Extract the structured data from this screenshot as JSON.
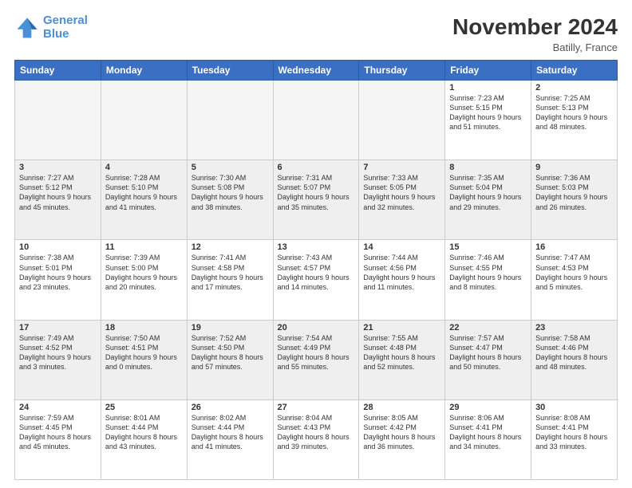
{
  "logo": {
    "line1": "General",
    "line2": "Blue"
  },
  "title": "November 2024",
  "location": "Batilly, France",
  "weekdays": [
    "Sunday",
    "Monday",
    "Tuesday",
    "Wednesday",
    "Thursday",
    "Friday",
    "Saturday"
  ],
  "rows": [
    [
      {
        "day": "",
        "empty": true
      },
      {
        "day": "",
        "empty": true
      },
      {
        "day": "",
        "empty": true
      },
      {
        "day": "",
        "empty": true
      },
      {
        "day": "",
        "empty": true
      },
      {
        "day": "1",
        "sunrise": "7:23 AM",
        "sunset": "5:15 PM",
        "daylight": "9 hours and 51 minutes."
      },
      {
        "day": "2",
        "sunrise": "7:25 AM",
        "sunset": "5:13 PM",
        "daylight": "9 hours and 48 minutes."
      }
    ],
    [
      {
        "day": "3",
        "sunrise": "7:27 AM",
        "sunset": "5:12 PM",
        "daylight": "9 hours and 45 minutes."
      },
      {
        "day": "4",
        "sunrise": "7:28 AM",
        "sunset": "5:10 PM",
        "daylight": "9 hours and 41 minutes."
      },
      {
        "day": "5",
        "sunrise": "7:30 AM",
        "sunset": "5:08 PM",
        "daylight": "9 hours and 38 minutes."
      },
      {
        "day": "6",
        "sunrise": "7:31 AM",
        "sunset": "5:07 PM",
        "daylight": "9 hours and 35 minutes."
      },
      {
        "day": "7",
        "sunrise": "7:33 AM",
        "sunset": "5:05 PM",
        "daylight": "9 hours and 32 minutes."
      },
      {
        "day": "8",
        "sunrise": "7:35 AM",
        "sunset": "5:04 PM",
        "daylight": "9 hours and 29 minutes."
      },
      {
        "day": "9",
        "sunrise": "7:36 AM",
        "sunset": "5:03 PM",
        "daylight": "9 hours and 26 minutes."
      }
    ],
    [
      {
        "day": "10",
        "sunrise": "7:38 AM",
        "sunset": "5:01 PM",
        "daylight": "9 hours and 23 minutes."
      },
      {
        "day": "11",
        "sunrise": "7:39 AM",
        "sunset": "5:00 PM",
        "daylight": "9 hours and 20 minutes."
      },
      {
        "day": "12",
        "sunrise": "7:41 AM",
        "sunset": "4:58 PM",
        "daylight": "9 hours and 17 minutes."
      },
      {
        "day": "13",
        "sunrise": "7:43 AM",
        "sunset": "4:57 PM",
        "daylight": "9 hours and 14 minutes."
      },
      {
        "day": "14",
        "sunrise": "7:44 AM",
        "sunset": "4:56 PM",
        "daylight": "9 hours and 11 minutes."
      },
      {
        "day": "15",
        "sunrise": "7:46 AM",
        "sunset": "4:55 PM",
        "daylight": "9 hours and 8 minutes."
      },
      {
        "day": "16",
        "sunrise": "7:47 AM",
        "sunset": "4:53 PM",
        "daylight": "9 hours and 5 minutes."
      }
    ],
    [
      {
        "day": "17",
        "sunrise": "7:49 AM",
        "sunset": "4:52 PM",
        "daylight": "9 hours and 3 minutes."
      },
      {
        "day": "18",
        "sunrise": "7:50 AM",
        "sunset": "4:51 PM",
        "daylight": "9 hours and 0 minutes."
      },
      {
        "day": "19",
        "sunrise": "7:52 AM",
        "sunset": "4:50 PM",
        "daylight": "8 hours and 57 minutes."
      },
      {
        "day": "20",
        "sunrise": "7:54 AM",
        "sunset": "4:49 PM",
        "daylight": "8 hours and 55 minutes."
      },
      {
        "day": "21",
        "sunrise": "7:55 AM",
        "sunset": "4:48 PM",
        "daylight": "8 hours and 52 minutes."
      },
      {
        "day": "22",
        "sunrise": "7:57 AM",
        "sunset": "4:47 PM",
        "daylight": "8 hours and 50 minutes."
      },
      {
        "day": "23",
        "sunrise": "7:58 AM",
        "sunset": "4:46 PM",
        "daylight": "8 hours and 48 minutes."
      }
    ],
    [
      {
        "day": "24",
        "sunrise": "7:59 AM",
        "sunset": "4:45 PM",
        "daylight": "8 hours and 45 minutes."
      },
      {
        "day": "25",
        "sunrise": "8:01 AM",
        "sunset": "4:44 PM",
        "daylight": "8 hours and 43 minutes."
      },
      {
        "day": "26",
        "sunrise": "8:02 AM",
        "sunset": "4:44 PM",
        "daylight": "8 hours and 41 minutes."
      },
      {
        "day": "27",
        "sunrise": "8:04 AM",
        "sunset": "4:43 PM",
        "daylight": "8 hours and 39 minutes."
      },
      {
        "day": "28",
        "sunrise": "8:05 AM",
        "sunset": "4:42 PM",
        "daylight": "8 hours and 36 minutes."
      },
      {
        "day": "29",
        "sunrise": "8:06 AM",
        "sunset": "4:41 PM",
        "daylight": "8 hours and 34 minutes."
      },
      {
        "day": "30",
        "sunrise": "8:08 AM",
        "sunset": "4:41 PM",
        "daylight": "8 hours and 33 minutes."
      }
    ]
  ],
  "labels": {
    "sunrise": "Sunrise:",
    "sunset": "Sunset:",
    "daylight": "Daylight hours"
  }
}
